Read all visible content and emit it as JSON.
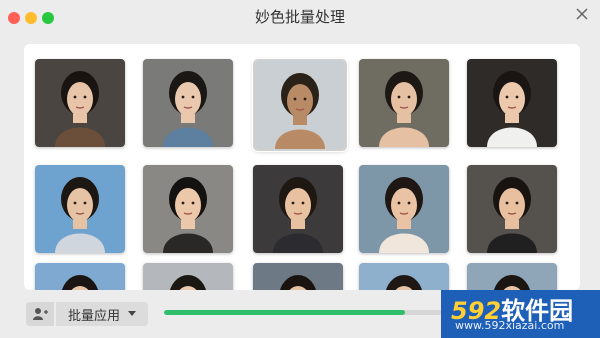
{
  "window": {
    "title": "妙色批量处理"
  },
  "colors": {
    "accent": "#2fbf6b",
    "close": "#fe5f57",
    "minimize": "#febc2e",
    "maximize": "#28c840"
  },
  "gallery": {
    "thumbnails": [
      {
        "bg": "#4a4540",
        "skin": "#e8c4a8",
        "hair": "#1a1410",
        "shirt": "#6b4f3a"
      },
      {
        "bg": "#7a7a78",
        "skin": "#eac8ae",
        "hair": "#1b1715",
        "shirt": "#5d7fa0"
      },
      {
        "bg": "#c9cfd3",
        "skin": "#b98a66",
        "hair": "#2a2118",
        "shirt": "#b98a66"
      },
      {
        "bg": "#6f6c62",
        "skin": "#e6c0a2",
        "hair": "#1e1814",
        "shirt": "#e6c0a2"
      },
      {
        "bg": "#2e2b28",
        "skin": "#ecc9ad",
        "hair": "#1a1512",
        "shirt": "#f0f0ee"
      },
      {
        "bg": "#6fa3cf",
        "skin": "#e7c3a5",
        "hair": "#1c1713",
        "shirt": "#cfd6dd"
      },
      {
        "bg": "#8a8884",
        "skin": "#ecc8aa",
        "hair": "#141210",
        "shirt": "#2a2826"
      },
      {
        "bg": "#3c3a3a",
        "skin": "#e8c1a1",
        "hair": "#1e1712",
        "shirt": "#2c2c30"
      },
      {
        "bg": "#7e97a8",
        "skin": "#e9c3a4",
        "hair": "#1e1713",
        "shirt": "#f1e6dc"
      },
      {
        "bg": "#55524e",
        "skin": "#e8c0a0",
        "hair": "#181310",
        "shirt": "#202020"
      },
      {
        "bg": "#7fa9d0",
        "skin": "#e8c5a8",
        "hair": "#1a1512",
        "shirt": "#dbe3ea"
      },
      {
        "bg": "#b4b8bc",
        "skin": "#eccaae",
        "hair": "#1b1713",
        "shirt": "#cccccc"
      },
      {
        "bg": "#6d7a86",
        "skin": "#e6c2a4",
        "hair": "#1a1411",
        "shirt": "#8a8a8a"
      },
      {
        "bg": "#8eb0cc",
        "skin": "#e8c4a6",
        "hair": "#1e1713",
        "shirt": "#e0e0e0"
      },
      {
        "bg": "#8fa6b8",
        "skin": "#eac5a7",
        "hair": "#1b1612",
        "shirt": "#d6d6d6"
      }
    ],
    "selected_index": 2
  },
  "toolbar": {
    "apply_label": "批量应用",
    "progress": 0.86
  },
  "watermark": {
    "brand_number": "592",
    "brand_text": "软件园",
    "url": "www.592xiazai.com"
  }
}
